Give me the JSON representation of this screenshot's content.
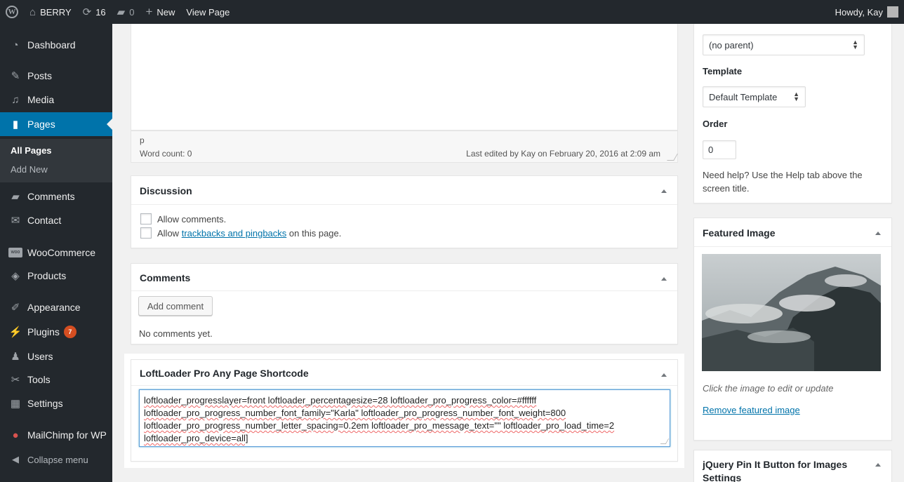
{
  "adminbar": {
    "site_name": "BERRY",
    "updates_count": "16",
    "comments_count": "0",
    "new_label": "New",
    "view_page": "View Page",
    "greeting": "Howdy, Kay"
  },
  "sidebar": {
    "items": [
      {
        "label": "Dashboard",
        "icon": "dashboard-icon"
      },
      {
        "label": "Posts",
        "icon": "pin-icon"
      },
      {
        "label": "Media",
        "icon": "media-icon"
      },
      {
        "label": "Pages",
        "icon": "pages-icon"
      },
      {
        "label": "Comments",
        "icon": "comment-icon"
      },
      {
        "label": "Contact",
        "icon": "envelope-icon"
      },
      {
        "label": "WooCommerce",
        "icon": "woo-icon"
      },
      {
        "label": "Products",
        "icon": "products-icon"
      },
      {
        "label": "Appearance",
        "icon": "brush-icon"
      },
      {
        "label": "Plugins",
        "icon": "plug-icon",
        "badge": "7"
      },
      {
        "label": "Users",
        "icon": "users-icon"
      },
      {
        "label": "Tools",
        "icon": "wrench-icon"
      },
      {
        "label": "Settings",
        "icon": "settings-icon"
      },
      {
        "label": "MailChimp for WP",
        "icon": "mailchimp-icon"
      }
    ],
    "submenu": {
      "all_pages": "All Pages",
      "add_new": "Add New"
    },
    "collapse": "Collapse menu"
  },
  "editor": {
    "path": "p",
    "word_count": "Word count: 0",
    "last_edited": "Last edited by Kay on February 20, 2016 at 2:09 am"
  },
  "discussion": {
    "title": "Discussion",
    "allow_comments": "Allow comments.",
    "allow_prefix": "Allow",
    "trackbacks_link": "trackbacks and pingbacks",
    "allow_suffix": "on this page."
  },
  "comments_box": {
    "title": "Comments",
    "add_button": "Add comment",
    "empty": "No comments yet."
  },
  "loftloader": {
    "title": "LoftLoader Pro Any Page Shortcode",
    "lines": [
      "loftloader_progresslayer=front loftloader_percentagesize=28 loftloader_pro_progress_color=#ffffff",
      "loftloader_pro_progress_number_font_family=\"Karla\" loftloader_pro_progress_number_font_weight=800",
      "loftloader_pro_progress_number_letter_spacing=0.2em loftloader_pro_message_text=\"\" loftloader_pro_load_time=2",
      "loftloader_pro_device=all]"
    ]
  },
  "attributes": {
    "parent_value": "(no parent)",
    "template_label": "Template",
    "template_value": "Default Template",
    "order_label": "Order",
    "order_value": "0",
    "help": "Need help? Use the Help tab above the screen title."
  },
  "featured_image": {
    "title": "Featured Image",
    "caption": "Click the image to edit or update",
    "remove": "Remove featured image"
  },
  "pin_it": {
    "title_line1": "jQuery Pin It Button for Images",
    "title_line2": "Settings"
  },
  "colors": {
    "admin_dark": "#23282d",
    "accent_blue": "#0073aa",
    "badge_orange": "#d54e21"
  }
}
